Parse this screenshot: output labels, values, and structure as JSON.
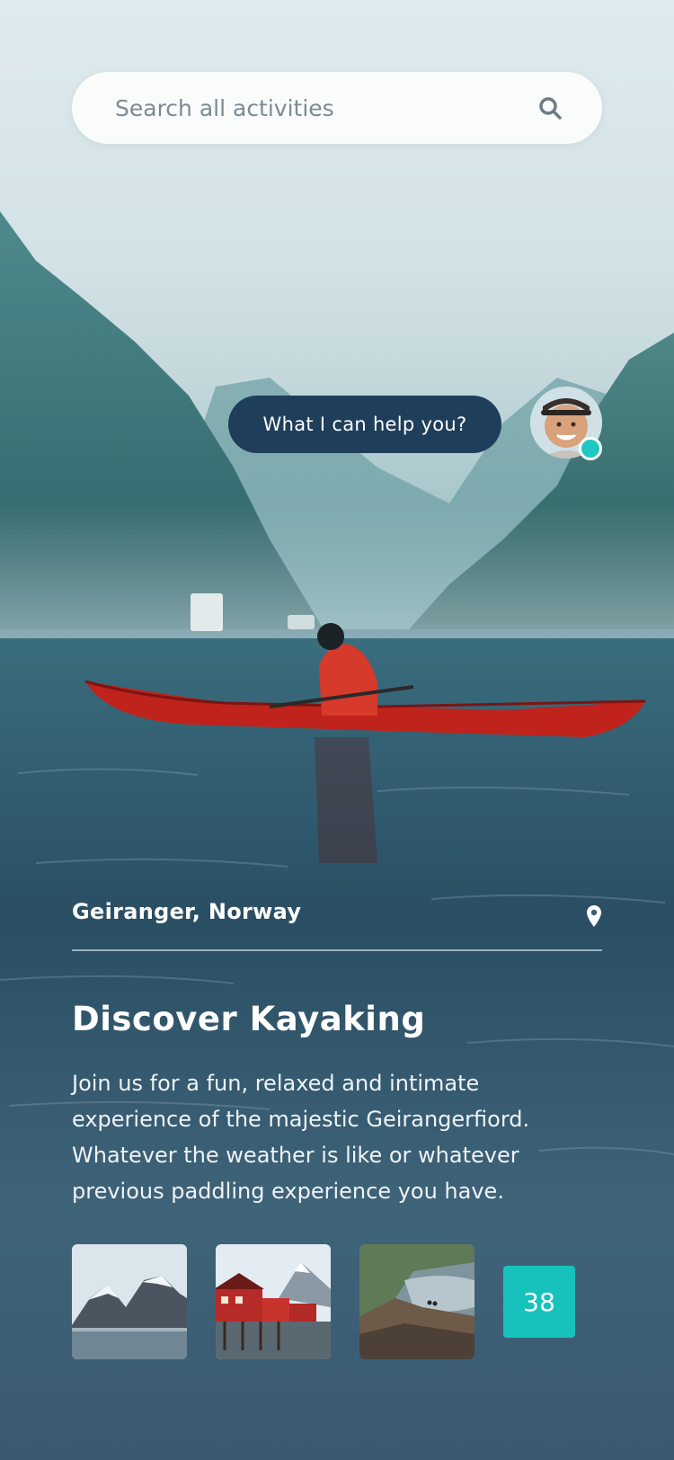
{
  "search": {
    "placeholder": "Search all activities",
    "icon": "search-icon"
  },
  "chat": {
    "message": "What I can help you?",
    "status_color": "#1ec8c0"
  },
  "location": {
    "name": "Geiranger, Norway",
    "icon": "map-pin-icon"
  },
  "activity": {
    "title": "Discover Kayaking",
    "description": "Join us for a fun, relaxed and intimate experience of the majestic Geirangerfiord. Whatever the weather is like or whatever previous paddling experience you have."
  },
  "gallery": {
    "thumbnails": [
      "snowy-mountains",
      "red-cabins",
      "fjord-cliff"
    ],
    "more_count": "38"
  },
  "colors": {
    "accent": "#17c2bd",
    "bubble": "#1f3e5a"
  }
}
